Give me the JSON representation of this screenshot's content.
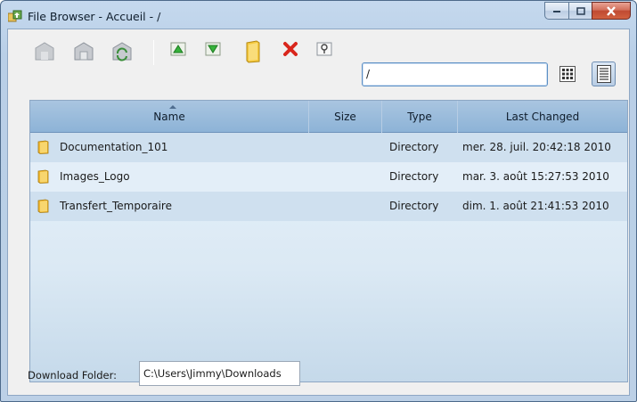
{
  "window": {
    "title": "File Browser - Accueil - /"
  },
  "toolbar": {
    "buttons": [
      {
        "icon": "home-disabled-icon"
      },
      {
        "icon": "home-icon"
      },
      {
        "icon": "refresh-icon"
      },
      {
        "icon": "arrow-up-icon"
      },
      {
        "icon": "arrow-down-icon"
      },
      {
        "icon": "new-folder-icon"
      },
      {
        "icon": "delete-icon"
      },
      {
        "icon": "rename-icon"
      }
    ],
    "path_value": "/"
  },
  "table": {
    "columns": [
      "Name",
      "Size",
      "Type",
      "Last Changed"
    ],
    "rows": [
      {
        "name": "Documentation_101",
        "size": "",
        "type": "Directory",
        "last_changed": "mer. 28. juil. 20:42:18 2010"
      },
      {
        "name": "Images_Logo",
        "size": "",
        "type": "Directory",
        "last_changed": "mar. 3. août 15:27:53 2010"
      },
      {
        "name": "Transfert_Temporaire",
        "size": "",
        "type": "Directory",
        "last_changed": "dim. 1. août 21:41:53 2010"
      }
    ]
  },
  "footer": {
    "download_label": "Download Folder:",
    "download_path": "C:\\Users\\Jimmy\\Downloads"
  },
  "colors": {
    "accent": "#5c8fc5",
    "folder": "#f0b72e",
    "delete": "#d9261c",
    "close_button": "#c04a32"
  }
}
